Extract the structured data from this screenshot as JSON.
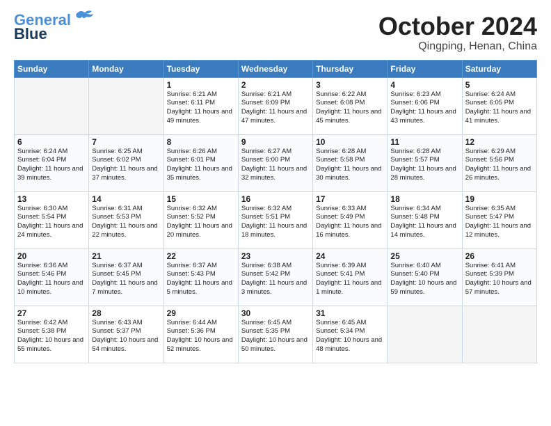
{
  "header": {
    "logo_line1": "General",
    "logo_line2": "Blue",
    "month": "October 2024",
    "location": "Qingping, Henan, China"
  },
  "days_of_week": [
    "Sunday",
    "Monday",
    "Tuesday",
    "Wednesday",
    "Thursday",
    "Friday",
    "Saturday"
  ],
  "weeks": [
    [
      {
        "day": "",
        "info": ""
      },
      {
        "day": "",
        "info": ""
      },
      {
        "day": "1",
        "info": "Sunrise: 6:21 AM\nSunset: 6:11 PM\nDaylight: 11 hours and 49 minutes."
      },
      {
        "day": "2",
        "info": "Sunrise: 6:21 AM\nSunset: 6:09 PM\nDaylight: 11 hours and 47 minutes."
      },
      {
        "day": "3",
        "info": "Sunrise: 6:22 AM\nSunset: 6:08 PM\nDaylight: 11 hours and 45 minutes."
      },
      {
        "day": "4",
        "info": "Sunrise: 6:23 AM\nSunset: 6:06 PM\nDaylight: 11 hours and 43 minutes."
      },
      {
        "day": "5",
        "info": "Sunrise: 6:24 AM\nSunset: 6:05 PM\nDaylight: 11 hours and 41 minutes."
      }
    ],
    [
      {
        "day": "6",
        "info": "Sunrise: 6:24 AM\nSunset: 6:04 PM\nDaylight: 11 hours and 39 minutes."
      },
      {
        "day": "7",
        "info": "Sunrise: 6:25 AM\nSunset: 6:02 PM\nDaylight: 11 hours and 37 minutes."
      },
      {
        "day": "8",
        "info": "Sunrise: 6:26 AM\nSunset: 6:01 PM\nDaylight: 11 hours and 35 minutes."
      },
      {
        "day": "9",
        "info": "Sunrise: 6:27 AM\nSunset: 6:00 PM\nDaylight: 11 hours and 32 minutes."
      },
      {
        "day": "10",
        "info": "Sunrise: 6:28 AM\nSunset: 5:58 PM\nDaylight: 11 hours and 30 minutes."
      },
      {
        "day": "11",
        "info": "Sunrise: 6:28 AM\nSunset: 5:57 PM\nDaylight: 11 hours and 28 minutes."
      },
      {
        "day": "12",
        "info": "Sunrise: 6:29 AM\nSunset: 5:56 PM\nDaylight: 11 hours and 26 minutes."
      }
    ],
    [
      {
        "day": "13",
        "info": "Sunrise: 6:30 AM\nSunset: 5:54 PM\nDaylight: 11 hours and 24 minutes."
      },
      {
        "day": "14",
        "info": "Sunrise: 6:31 AM\nSunset: 5:53 PM\nDaylight: 11 hours and 22 minutes."
      },
      {
        "day": "15",
        "info": "Sunrise: 6:32 AM\nSunset: 5:52 PM\nDaylight: 11 hours and 20 minutes."
      },
      {
        "day": "16",
        "info": "Sunrise: 6:32 AM\nSunset: 5:51 PM\nDaylight: 11 hours and 18 minutes."
      },
      {
        "day": "17",
        "info": "Sunrise: 6:33 AM\nSunset: 5:49 PM\nDaylight: 11 hours and 16 minutes."
      },
      {
        "day": "18",
        "info": "Sunrise: 6:34 AM\nSunset: 5:48 PM\nDaylight: 11 hours and 14 minutes."
      },
      {
        "day": "19",
        "info": "Sunrise: 6:35 AM\nSunset: 5:47 PM\nDaylight: 11 hours and 12 minutes."
      }
    ],
    [
      {
        "day": "20",
        "info": "Sunrise: 6:36 AM\nSunset: 5:46 PM\nDaylight: 11 hours and 10 minutes."
      },
      {
        "day": "21",
        "info": "Sunrise: 6:37 AM\nSunset: 5:45 PM\nDaylight: 11 hours and 7 minutes."
      },
      {
        "day": "22",
        "info": "Sunrise: 6:37 AM\nSunset: 5:43 PM\nDaylight: 11 hours and 5 minutes."
      },
      {
        "day": "23",
        "info": "Sunrise: 6:38 AM\nSunset: 5:42 PM\nDaylight: 11 hours and 3 minutes."
      },
      {
        "day": "24",
        "info": "Sunrise: 6:39 AM\nSunset: 5:41 PM\nDaylight: 11 hours and 1 minute."
      },
      {
        "day": "25",
        "info": "Sunrise: 6:40 AM\nSunset: 5:40 PM\nDaylight: 10 hours and 59 minutes."
      },
      {
        "day": "26",
        "info": "Sunrise: 6:41 AM\nSunset: 5:39 PM\nDaylight: 10 hours and 57 minutes."
      }
    ],
    [
      {
        "day": "27",
        "info": "Sunrise: 6:42 AM\nSunset: 5:38 PM\nDaylight: 10 hours and 55 minutes."
      },
      {
        "day": "28",
        "info": "Sunrise: 6:43 AM\nSunset: 5:37 PM\nDaylight: 10 hours and 54 minutes."
      },
      {
        "day": "29",
        "info": "Sunrise: 6:44 AM\nSunset: 5:36 PM\nDaylight: 10 hours and 52 minutes."
      },
      {
        "day": "30",
        "info": "Sunrise: 6:45 AM\nSunset: 5:35 PM\nDaylight: 10 hours and 50 minutes."
      },
      {
        "day": "31",
        "info": "Sunrise: 6:45 AM\nSunset: 5:34 PM\nDaylight: 10 hours and 48 minutes."
      },
      {
        "day": "",
        "info": ""
      },
      {
        "day": "",
        "info": ""
      }
    ]
  ]
}
